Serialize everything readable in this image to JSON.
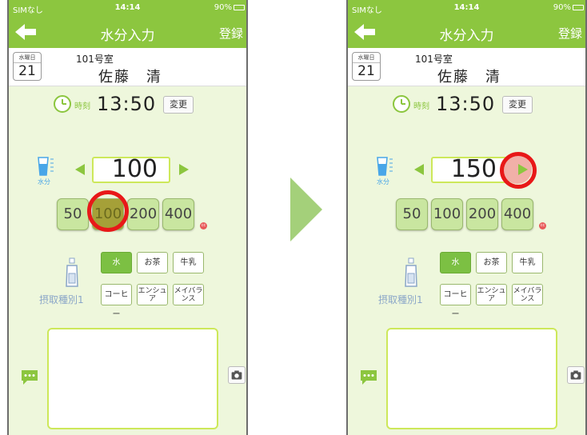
{
  "status": {
    "carrier": "SIMなし",
    "time": "14:14",
    "battery": "90%"
  },
  "nav": {
    "title": "水分入力",
    "register": "登録"
  },
  "date": {
    "weekday": "水曜日",
    "day": "21"
  },
  "resident": {
    "room": "101号室",
    "name": "佐藤　清"
  },
  "time_row": {
    "label": "時刻",
    "value": "13:50",
    "change": "変更"
  },
  "water": {
    "label": "水分"
  },
  "amount_left": "100",
  "amount_right": "150",
  "presets": [
    "50",
    "100",
    "200",
    "400"
  ],
  "clear_badge": "cc",
  "intake_label": "摂取種別1",
  "drink_types": [
    "水",
    "お茶",
    "牛乳",
    "コーヒー",
    "エンシュア",
    "メイバランス"
  ],
  "colors": {
    "accent": "#8cc63f",
    "highlight": "#e81818",
    "panel": "#eef7dc"
  }
}
